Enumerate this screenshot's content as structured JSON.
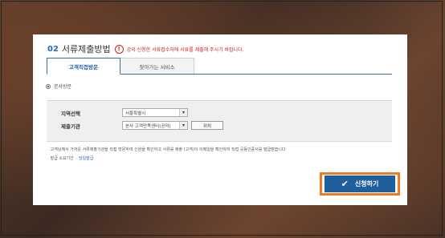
{
  "section": {
    "number": "02",
    "title": "서류제출방법",
    "notice": "강의 신청한 서류접수처에 서류를 제출해 주시기 바랍니다."
  },
  "tabs": [
    {
      "label": "고객직접방문",
      "active": true
    },
    {
      "label": "찾아가는 서비스",
      "active": false
    }
  ],
  "visit_option": {
    "label": "본사방문",
    "selected": true
  },
  "form": {
    "region": {
      "label": "지역선택",
      "value": "서울특별시"
    },
    "institution": {
      "label": "제출기관",
      "value": "본사 고객만족센터(공덕)",
      "location_button": "위치"
    }
  },
  "notes": {
    "line1": "고객님께서 가까운 서류제출기관을 직접 방문하여 신원을 확인하고 서류를 제출 (고객)이 이메일을 확인하여 직접 공동인증서를 발급받습니다",
    "line2_prefix": "발급 소요기간 :",
    "line2_link": "당일발급"
  },
  "submit": {
    "label": "신청하기",
    "icon": "check-icon"
  },
  "colors": {
    "accent": "#1f5f9e",
    "warning": "#d0201a",
    "highlight": "#ef7a24"
  }
}
